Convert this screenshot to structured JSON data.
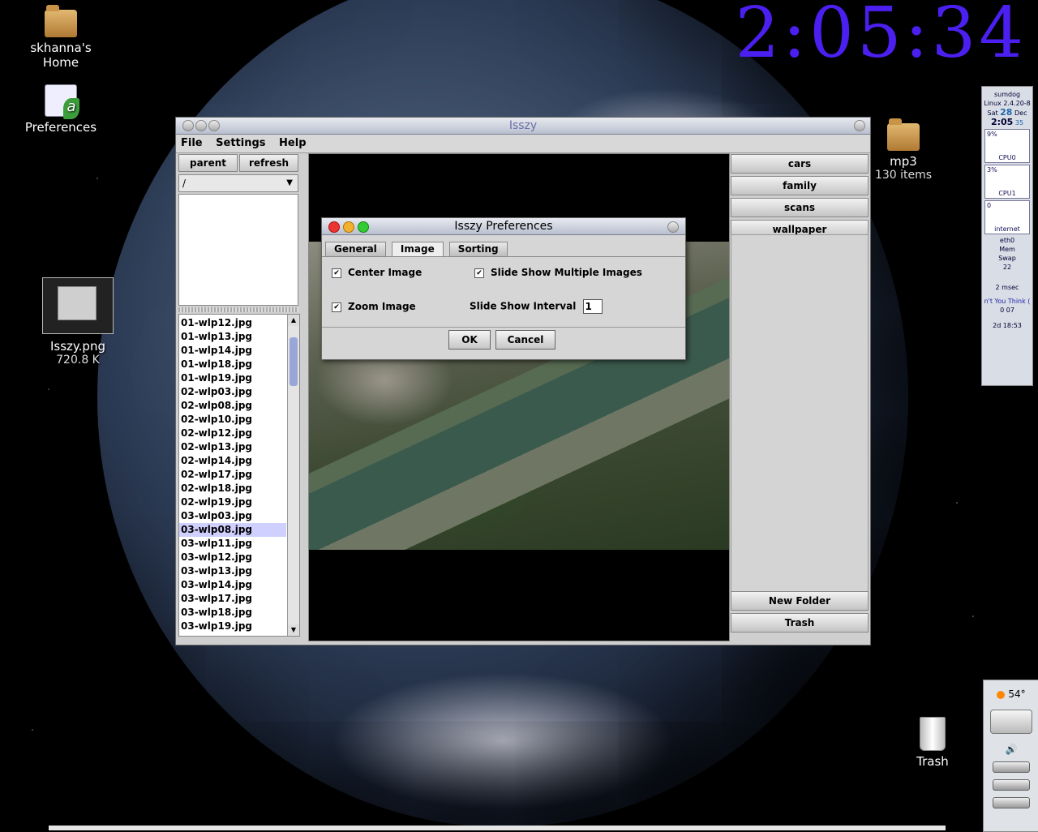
{
  "clock": "2:05:34",
  "desktop": {
    "home_label": "skhanna's Home",
    "prefs_label": "Preferences",
    "image_name": "Isszy.png",
    "image_size": "720.8 K",
    "mp3_name": "mp3",
    "mp3_count": "130 items",
    "trash_label": "Trash"
  },
  "window": {
    "title": "Isszy",
    "menu": [
      "File",
      "Settings",
      "Help"
    ],
    "parent_label": "parent",
    "refresh_label": "refresh",
    "path": "/",
    "files": [
      "01-wlp12.jpg",
      "01-wlp13.jpg",
      "01-wlp14.jpg",
      "01-wlp18.jpg",
      "01-wlp19.jpg",
      "02-wlp03.jpg",
      "02-wlp08.jpg",
      "02-wlp10.jpg",
      "02-wlp12.jpg",
      "02-wlp13.jpg",
      "02-wlp14.jpg",
      "02-wlp17.jpg",
      "02-wlp18.jpg",
      "02-wlp19.jpg",
      "03-wlp03.jpg",
      "03-wlp08.jpg",
      "03-wlp11.jpg",
      "03-wlp12.jpg",
      "03-wlp13.jpg",
      "03-wlp14.jpg",
      "03-wlp17.jpg",
      "03-wlp18.jpg",
      "03-wlp19.jpg"
    ],
    "selected_file": "03-wlp08.jpg",
    "folders": [
      "cars",
      "family",
      "scans",
      "wallpaper"
    ],
    "new_folder_label": "New Folder",
    "trash_label": "Trash"
  },
  "dialog": {
    "title": "Isszy Preferences",
    "tabs": [
      "General",
      "Image",
      "Sorting"
    ],
    "active_tab": "Image",
    "center_image": "Center Image",
    "zoom_image": "Zoom Image",
    "slide_multi": "Slide Show Multiple Images",
    "slide_interval_label": "Slide Show Interval",
    "slide_interval_value": "1",
    "ok_label": "OK",
    "cancel_label": "Cancel"
  },
  "monitor": {
    "host": "sumdog",
    "kernel": "Linux 2.4.20-8",
    "date_day": "Sat",
    "date_num": "28",
    "date_month": "Dec",
    "time": "2:05",
    "seconds": "35",
    "cpu0_pct": "9%",
    "cpu0_label": "CPU0",
    "cpu1_pct": "3%",
    "cpu1_label": "CPU1",
    "net_val": "0",
    "net_label": "internet",
    "eth_label": "eth0",
    "mem_label": "Mem",
    "swap_label": "Swap",
    "disk_val": "22",
    "ping_label": "2 msec",
    "song": "n't You Think (",
    "track": "0 07",
    "uptime": "2d 18:53"
  },
  "weather": {
    "temp": "54°"
  }
}
